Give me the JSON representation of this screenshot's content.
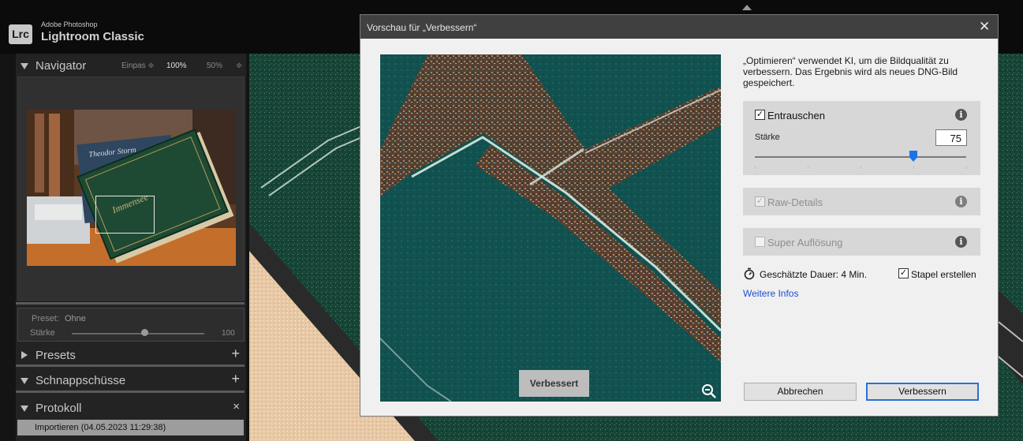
{
  "app": {
    "brand_sub": "Adobe Photoshop",
    "brand_main": "Lightroom Classic",
    "logo": "Lrc"
  },
  "left_panel": {
    "navigator": {
      "title": "Navigator",
      "zoom_fit": "Einpas ≑",
      "zoom_100": "100%",
      "zoom_50": "50%",
      "zoom_more": "≑"
    },
    "preset": {
      "label": "Preset:",
      "value": "Ohne",
      "strength_label": "Stärke",
      "strength_value": "100",
      "strength_fraction": 0.55
    },
    "presets": {
      "title": "Presets",
      "action": "+"
    },
    "snapshots": {
      "title": "Schnappschüsse",
      "action": "+"
    },
    "history": {
      "title": "Protokoll",
      "action": "×",
      "items": [
        "Importieren (04.05.2023 11:29:38)"
      ]
    }
  },
  "dialog": {
    "title": "Vorschau für „Verbessern“",
    "close_icon": "close-icon",
    "description": "„Optimieren“ verwendet KI, um die Bildqualität zu verbessern. Das Ergebnis wird als neues DNG-Bild gespeichert.",
    "preview_badge": "Verbessert",
    "denoise": {
      "label": "Entrauschen",
      "checked": true,
      "strength_label": "Stärke",
      "strength_value": "75",
      "strength_fraction": 0.75
    },
    "raw_details": {
      "label": "Raw-Details",
      "checked": true,
      "disabled": true
    },
    "super_resolution": {
      "label": "Super Auflösung",
      "checked": false,
      "disabled": true
    },
    "duration": "Geschätzte Dauer: 4 Min.",
    "create_stack": {
      "label": "Stapel erstellen",
      "checked": true
    },
    "more_info": "Weitere Infos",
    "cancel_label": "Abbrechen",
    "ok_label": "Verbessern",
    "accent_color": "#1a73e8"
  }
}
